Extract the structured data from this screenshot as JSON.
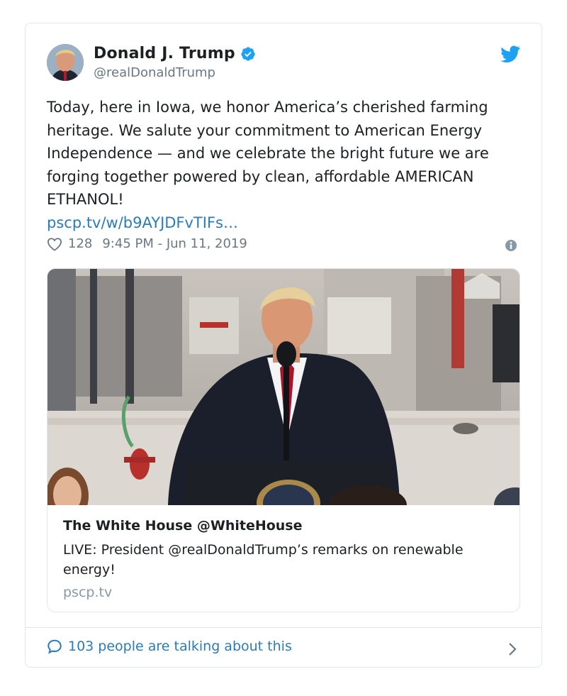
{
  "author": {
    "name": "Donald J. Trump",
    "handle": "@realDonaldTrump"
  },
  "tweet": {
    "text": "Today, here in Iowa, we honor America’s cherished farming heritage. We salute your commitment to American Energy Independence — and we celebrate the bright future we are forging together powered by clean, affordable AMERICAN ETHANOL!",
    "link": "pscp.tv/w/b9AYJDFvTIFs…",
    "likes": "128",
    "timestamp": "9:45 PM - Jun 11, 2019"
  },
  "card": {
    "title": "The White House @WhiteHouse",
    "description": "LIVE: President @realDonaldTrump’s remarks on renewable energy!",
    "domain": "pscp.tv"
  },
  "footer": {
    "conversation": "103 people are talking about this"
  },
  "icons": {
    "verified": "verified-badge-icon",
    "bird": "twitter-bird-icon",
    "heart": "heart-icon",
    "info": "info-icon",
    "reply": "reply-bubble-icon",
    "chevron": "chevron-right-icon"
  },
  "colors": {
    "link": "#2b7bb9",
    "verified": "#1da1f2",
    "muted": "#697882",
    "border": "#e1e8ed"
  }
}
